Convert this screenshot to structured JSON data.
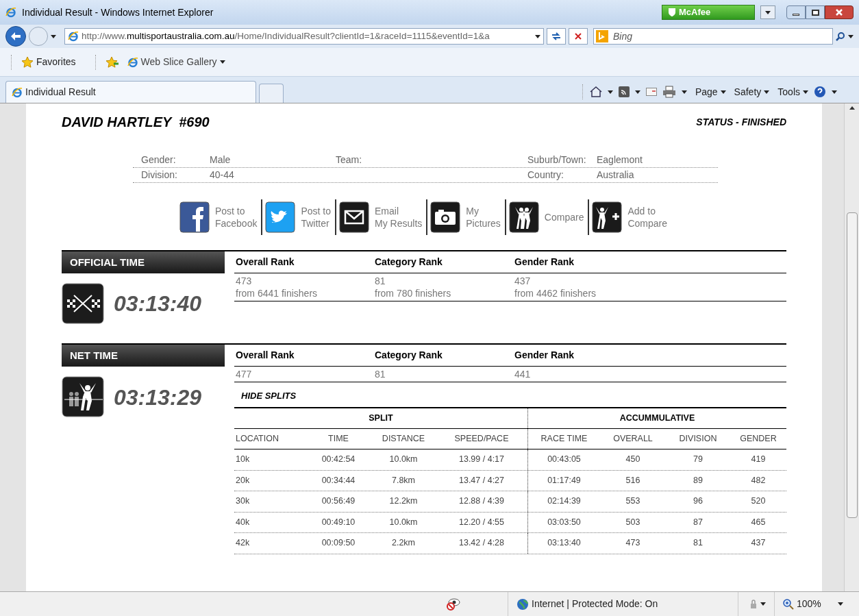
{
  "window": {
    "title": "Individual Result - Windows Internet Explorer",
    "addon": "McAfee"
  },
  "address_bar": {
    "prefix": "http://www.",
    "domain": "multisportaustralia.com.au",
    "path": "/Home/IndividualResult?clientId=1&raceId=1115&eventId=1&a"
  },
  "search": {
    "placeholder": "Bing"
  },
  "favorites_bar": {
    "favorites": "Favorites",
    "web_slice": "Web Slice Gallery"
  },
  "tab": {
    "label": "Individual Result"
  },
  "command_bar": [
    "Page",
    "Safety",
    "Tools"
  ],
  "athlete": {
    "name": "DAVID HARTLEY  #690",
    "status": "STATUS - FINISHED"
  },
  "details": [
    {
      "left": {
        "label": "Gender:",
        "value": "Male"
      },
      "middle": {
        "label": "Team:"
      },
      "right": {
        "label": "Suburb/Town:",
        "value": "Eaglemont"
      }
    },
    {
      "left": {
        "label": "Division:",
        "value": "40-44"
      },
      "right": {
        "label": "Country:",
        "value": "Australia"
      }
    }
  ],
  "actions": [
    {
      "kind": "facebook",
      "lines": [
        "Post to",
        "Facebook"
      ]
    },
    {
      "kind": "twitter",
      "lines": [
        "Post to",
        "Twitter"
      ]
    },
    {
      "kind": "email",
      "lines": [
        "Email",
        "My Results"
      ]
    },
    {
      "kind": "camera",
      "lines": [
        "My",
        "Pictures"
      ]
    },
    {
      "kind": "compare",
      "lines": [
        "Compare"
      ]
    },
    {
      "kind": "add",
      "lines": [
        "Add to",
        "Compare"
      ]
    }
  ],
  "times": [
    {
      "kind": "official",
      "title": "OFFICIAL TIME",
      "time": "03:13:40",
      "ranks": [
        {
          "heading": "Overall Rank",
          "value": "473",
          "note": "from 6441 finishers"
        },
        {
          "heading": "Category Rank",
          "value": "81",
          "note": "from 780 finishers"
        },
        {
          "heading": "Gender Rank",
          "value": "437",
          "note": "from 4462 finishers"
        }
      ]
    },
    {
      "kind": "net",
      "title": "NET TIME",
      "time": "03:13:29",
      "ranks": [
        {
          "heading": "Overall Rank",
          "value": "477"
        },
        {
          "heading": "Category Rank",
          "value": "81"
        },
        {
          "heading": "Gender Rank",
          "value": "441"
        }
      ]
    }
  ],
  "splits": {
    "toggle": "HIDE SPLITS",
    "groups": [
      "SPLIT",
      "ACCUMMULATIVE"
    ],
    "columns": [
      "LOCATION",
      "TIME",
      "DISTANCE",
      "SPEED/PACE",
      "RACE TIME",
      "OVERALL",
      "DIVISION",
      "GENDER"
    ],
    "rows": [
      [
        "10k",
        "00:42:54",
        "10.0km",
        "13.99 / 4:17",
        "00:43:05",
        "450",
        "79",
        "419"
      ],
      [
        "20k",
        "00:34:44",
        "7.8km",
        "13.47 / 4:27",
        "01:17:49",
        "516",
        "89",
        "482"
      ],
      [
        "30k",
        "00:56:49",
        "12.2km",
        "12.88 / 4:39",
        "02:14:39",
        "553",
        "96",
        "520"
      ],
      [
        "40k",
        "00:49:10",
        "10.0km",
        "12.20 / 4:55",
        "03:03:50",
        "503",
        "87",
        "465"
      ],
      [
        "42k",
        "00:09:50",
        "2.2km",
        "13.42 / 4:28",
        "03:13:40",
        "473",
        "81",
        "437"
      ]
    ]
  },
  "status_bar": {
    "zone": "Internet | Protected Mode: On",
    "zoom": "100%"
  }
}
